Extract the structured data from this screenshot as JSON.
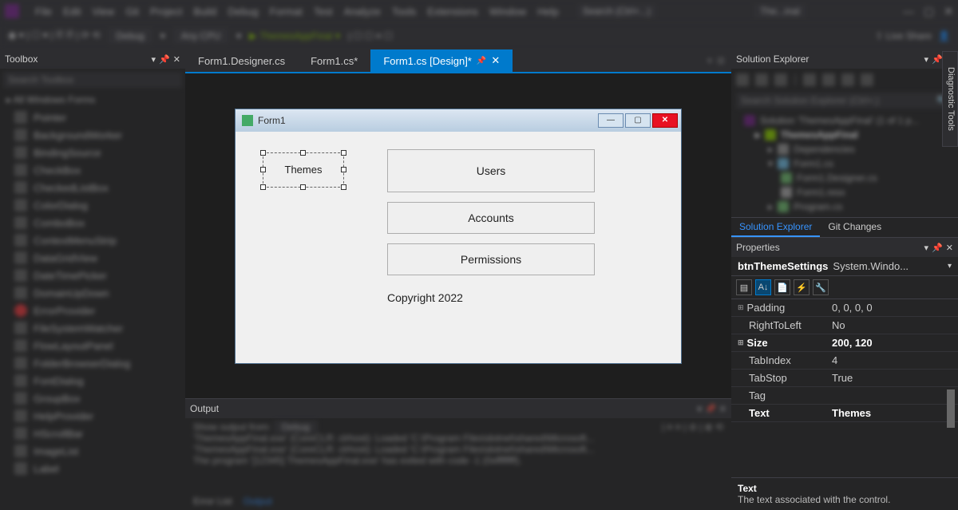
{
  "menubar": {
    "items": [
      "File",
      "Edit",
      "View",
      "Git",
      "Project",
      "Build",
      "Debug",
      "Format",
      "Test",
      "Analyze",
      "Tools",
      "Extensions",
      "Window",
      "Help"
    ],
    "search": "Search (Ctrl+...)",
    "title": "The...inal"
  },
  "toolbar": {
    "config": "Debug",
    "platform": "Any CPU",
    "run": "ThemesAppFinal",
    "share": "Live Share"
  },
  "toolbox": {
    "title": "Toolbox",
    "search": "Search Toolbox",
    "category": "▸ All Windows Forms",
    "items": [
      "Pointer",
      "BackgroundWorker",
      "BindingSource",
      "CheckBox",
      "CheckedListBox",
      "ColorDialog",
      "ComboBox",
      "ContextMenuStrip",
      "DataGridView",
      "DateTimePicker",
      "DomainUpDown",
      "ErrorProvider",
      "FileSystemWatcher",
      "FlowLayoutPanel",
      "FolderBrowserDialog",
      "FontDialog",
      "GroupBox",
      "HelpProvider",
      "HScrollBar",
      "ImageList",
      "Label"
    ]
  },
  "tabs": {
    "t0": "Form1.Designer.cs",
    "t1": "Form1.cs*",
    "t2": "Form1.cs [Design]*"
  },
  "form": {
    "title": "Form1",
    "themes": "Themes",
    "users": "Users",
    "accounts": "Accounts",
    "permissions": "Permissions",
    "copyright": "Copyright 2022"
  },
  "output": {
    "title": "Output",
    "showfrom": "Show output from:",
    "showval": "Debug",
    "line1": "'ThemesAppFinal.exe' (CoreCLR: clrhost): Loaded 'C:\\Program Files\\dotnet\\shared\\Microsoft...",
    "line2": "'ThemesAppFinal.exe' (CoreCLR: clrhost): Loaded 'C:\\Program Files\\dotnet\\shared\\Microsoft...",
    "line3": "The program '[12345] ThemesAppFinal.exe' has exited with code -1 (0xffffffff).",
    "errlist": "Error List",
    "outputtab": "Output"
  },
  "solution": {
    "title": "Solution Explorer",
    "search": "Search Solution Explorer (Ctrl+;)",
    "root": "Solution 'ThemesAppFinal' (1 of 1 p...",
    "proj": "ThemesAppFinal",
    "deps": "Dependencies",
    "form": "Form1.cs",
    "designer": "Form1.Designer.cs",
    "resx": "Form1.resx",
    "program": "Program.cs",
    "tab_sol": "Solution Explorer",
    "tab_git": "Git Changes"
  },
  "props": {
    "title": "Properties",
    "control_name": "btnThemeSettings",
    "control_type": "System.Windo...",
    "rows": [
      {
        "n": "Padding",
        "v": "0, 0, 0, 0",
        "expand": true
      },
      {
        "n": "RightToLeft",
        "v": "No"
      },
      {
        "n": "Size",
        "v": "200, 120",
        "expand": true,
        "bold": true
      },
      {
        "n": "TabIndex",
        "v": "4"
      },
      {
        "n": "TabStop",
        "v": "True"
      },
      {
        "n": "Tag",
        "v": ""
      },
      {
        "n": "Text",
        "v": "Themes",
        "bold": true
      }
    ],
    "desc_title": "Text",
    "desc_body": "The text associated with the control."
  },
  "diag": "Diagnostic Tools"
}
